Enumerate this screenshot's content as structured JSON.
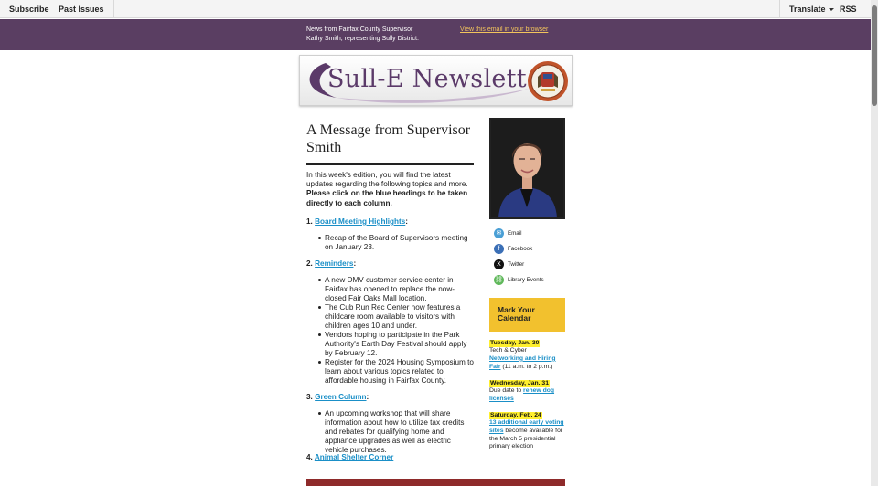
{
  "topnav": {
    "subscribe": "Subscribe",
    "past_issues": "Past Issues",
    "translate": "Translate",
    "rss": "RSS"
  },
  "banner": {
    "news_line1": "News from Fairfax County Supervisor",
    "news_line2": "Kathy Smith, representing Sully District.",
    "view_in_browser": "View this email in your browser"
  },
  "header": {
    "title": "Sull-E Newsletter"
  },
  "main": {
    "heading": "A Message from Supervisor Smith",
    "intro": "In this week's edition, you will find the latest updates regarding the following topics and more.",
    "intro_bold": "Please click on the blue headings to be taken directly to each column.",
    "sections": [
      {
        "number": "1.",
        "title": "Board Meeting Highlights",
        "suffix": ":",
        "bullets": [
          "Recap of the Board of Supervisors meeting on January 23."
        ]
      },
      {
        "number": "2.",
        "title": "Reminders",
        "suffix": ":",
        "bullets": [
          "A new DMV customer service center in Fairfax has opened to replace the now-closed Fair Oaks Mall location.",
          "The Cub Run Rec Center now features a childcare room available to visitors with children ages 10 and under.",
          "Vendors hoping to participate in the Park Authority's Earth Day Festival should apply by February 12.",
          "Register for the 2024 Housing Symposium to learn about various topics related to affordable housing in Fairfax County."
        ]
      },
      {
        "number": "3.",
        "title": "Green Column",
        "suffix": ":",
        "bullets": [
          "An upcoming workshop that will share information about how to utilize tax credits and rebates for qualifying home and appliance upgrades as well as electric vehicle purchases."
        ]
      },
      {
        "number": "4.",
        "title": "Animal Shelter Corner",
        "suffix": "",
        "bullets": []
      }
    ]
  },
  "sidebar": {
    "social": [
      {
        "label": "Email",
        "icon": "email-icon",
        "color": "#4a9fd5"
      },
      {
        "label": "Facebook",
        "icon": "facebook-icon",
        "color": "#3b6fb6"
      },
      {
        "label": "Twitter",
        "icon": "x-icon",
        "color": "#111111"
      },
      {
        "label": "Library Events",
        "icon": "link-icon",
        "color": "#5fb85a"
      }
    ],
    "calendar_title": "Mark Your Calendar",
    "events": [
      {
        "date": "Tuesday, Jan. 30",
        "pre": "Tech & Cyber",
        "link": "Networking and Hiring Fair",
        "post": "(11 a.m. to 2 p.m.)"
      },
      {
        "date": "Wednesday, Jan. 31",
        "pre": "Due date to",
        "link": "renew dog licenses",
        "post": ""
      },
      {
        "date": "Saturday, Feb. 24",
        "pre": "",
        "link": "13 additional early voting sites",
        "post": "become available for the March 5 presidential primary election"
      }
    ]
  },
  "colors": {
    "banner": "#5a3e62",
    "link": "#1a8fc7",
    "calendar": "#f2c12e",
    "highlight": "#ffef2e",
    "footer_bar": "#8e2a2a"
  }
}
